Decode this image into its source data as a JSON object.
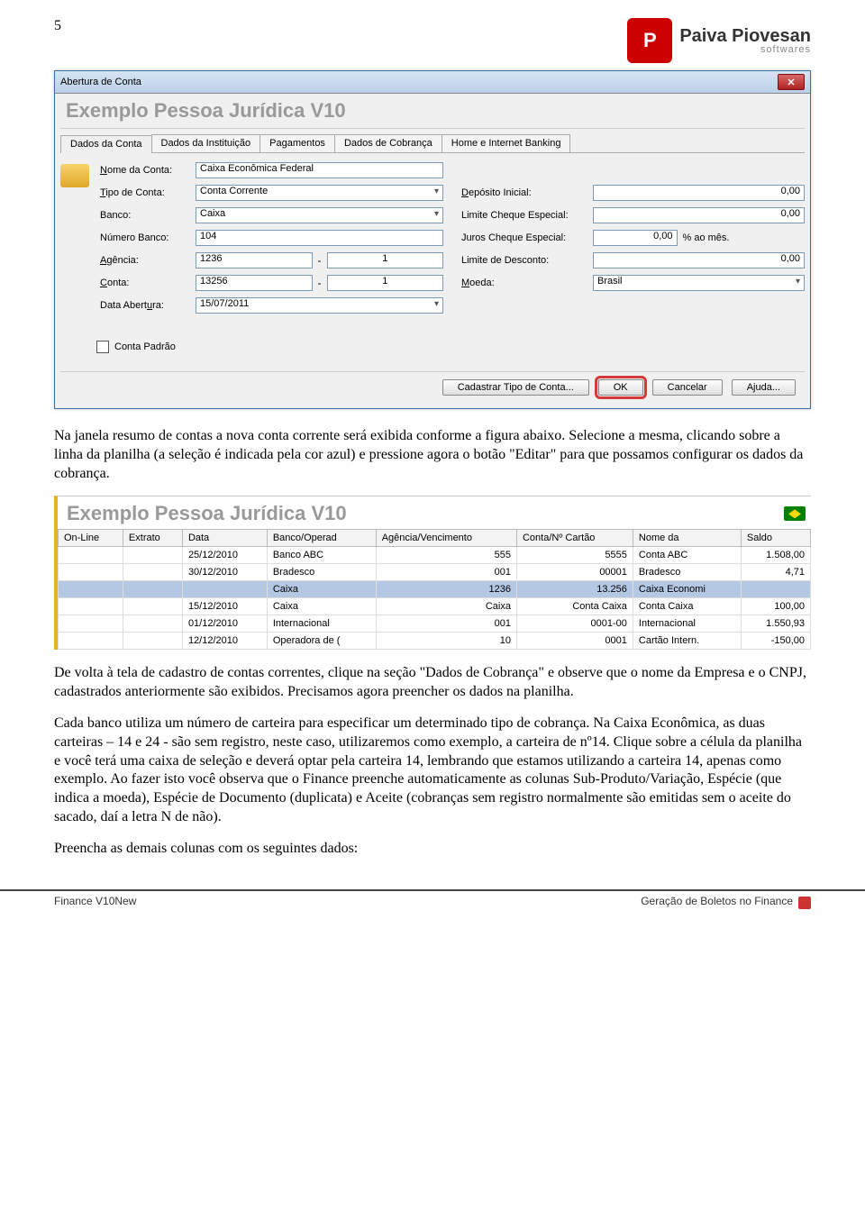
{
  "page_number": "5",
  "logo": {
    "name": "Paiva Piovesan",
    "sub": "softwares"
  },
  "dialog": {
    "title": "Abertura de Conta",
    "section_title": "Exemplo Pessoa Jurídica V10",
    "tabs": [
      "Dados da Conta",
      "Dados da Instituição",
      "Pagamentos",
      "Dados de Cobrança",
      "Home e Internet Banking"
    ],
    "labels": {
      "nome_conta": "Nome da Conta:",
      "tipo_conta": "Tipo de Conta:",
      "banco": "Banco:",
      "numero_banco": "Número Banco:",
      "agencia": "Agência:",
      "conta": "Conta:",
      "data_abertura": "Data Abertura:",
      "deposito_inicial": "Depósito Inicial:",
      "limite_cheque": "Limite Cheque Especial:",
      "juros_cheque": "Juros Cheque Especial:",
      "limite_desconto": "Limite de Desconto:",
      "moeda": "Moeda:"
    },
    "values": {
      "nome_conta": "Caixa Econômica Federal",
      "tipo_conta": "Conta Corrente",
      "banco": "Caixa",
      "numero_banco": "104",
      "agencia": "1236",
      "agencia_dv": "1",
      "conta": "13256",
      "conta_dv": "1",
      "data_abertura": "15/07/2011",
      "deposito_inicial": "0,00",
      "limite_cheque": "0,00",
      "juros_cheque": "0,00",
      "juros_suffix": "% ao mês.",
      "limite_desconto": "0,00",
      "moeda": "Brasil"
    },
    "checkbox_label": "Conta Padrão",
    "buttons": {
      "cadastrar": "Cadastrar Tipo de Conta...",
      "ok": "OK",
      "cancelar": "Cancelar",
      "ajuda": "Ajuda..."
    }
  },
  "para1": "Na janela resumo de contas a nova conta corrente será exibida conforme a figura abaixo. Selecione a mesma, clicando sobre a linha da planilha (a seleção é indicada pela cor azul) e pressione agora o botão \"Editar\" para que possamos configurar os dados da cobrança.",
  "table_window": {
    "title": "Exemplo Pessoa Jurídica V10",
    "headers": [
      "On-Line",
      "Extrato",
      "Data",
      "Banco/Operad",
      "Agência/Vencimento",
      "Conta/Nº Cartão",
      "Nome da",
      "Saldo"
    ],
    "rows": [
      {
        "data": "25/12/2010",
        "banco": "Banco ABC",
        "agencia": "555",
        "conta": "5555",
        "nome": "Conta ABC",
        "saldo": "1.508,00"
      },
      {
        "data": "30/12/2010",
        "banco": "Bradesco",
        "agencia": "001",
        "conta": "00001",
        "nome": "Bradesco",
        "saldo": "4,71"
      },
      {
        "data": "",
        "banco": "Caixa",
        "agencia": "1236",
        "conta": "13.256",
        "nome": "Caixa Economi",
        "saldo": "",
        "selected": true
      },
      {
        "data": "15/12/2010",
        "banco": "Caixa",
        "agencia": "Caixa",
        "conta": "Conta Caixa",
        "nome": "Conta Caixa",
        "saldo": "100,00"
      },
      {
        "data": "01/12/2010",
        "banco": "Internacional",
        "agencia": "001",
        "conta": "0001-00",
        "nome": "Internacional",
        "saldo": "1.550,93"
      },
      {
        "data": "12/12/2010",
        "banco": "Operadora de (",
        "agencia": "10",
        "conta": "0001",
        "nome": "Cartão Intern.",
        "saldo": "-150,00"
      }
    ]
  },
  "para2": "De volta à tela de cadastro de contas correntes, clique na seção \"Dados de Cobrança\" e observe que o nome da Empresa e o CNPJ, cadastrados anteriormente são exibidos. Precisamos agora preencher os dados na planilha.",
  "para3": "Cada banco utiliza um número de carteira para especificar um determinado tipo de cobrança. Na Caixa Econômica, as duas carteiras – 14 e 24 - são sem registro, neste caso, utilizaremos como exemplo, a carteira de nº14. Clique sobre a célula da planilha e você terá uma caixa de seleção e deverá optar pela carteira 14, lembrando que estamos utilizando a carteira 14, apenas como exemplo. Ao fazer isto você observa que o Finance preenche automaticamente as colunas Sub-Produto/Variação, Espécie (que indica a moeda), Espécie de Documento (duplicata) e Aceite (cobranças sem registro normalmente são emitidas sem o aceite do sacado, daí a letra N de não).",
  "para4": "Preencha as demais colunas com os seguintes dados:",
  "footer": {
    "left": "Finance V10New",
    "right": "Geração de Boletos no Finance"
  }
}
